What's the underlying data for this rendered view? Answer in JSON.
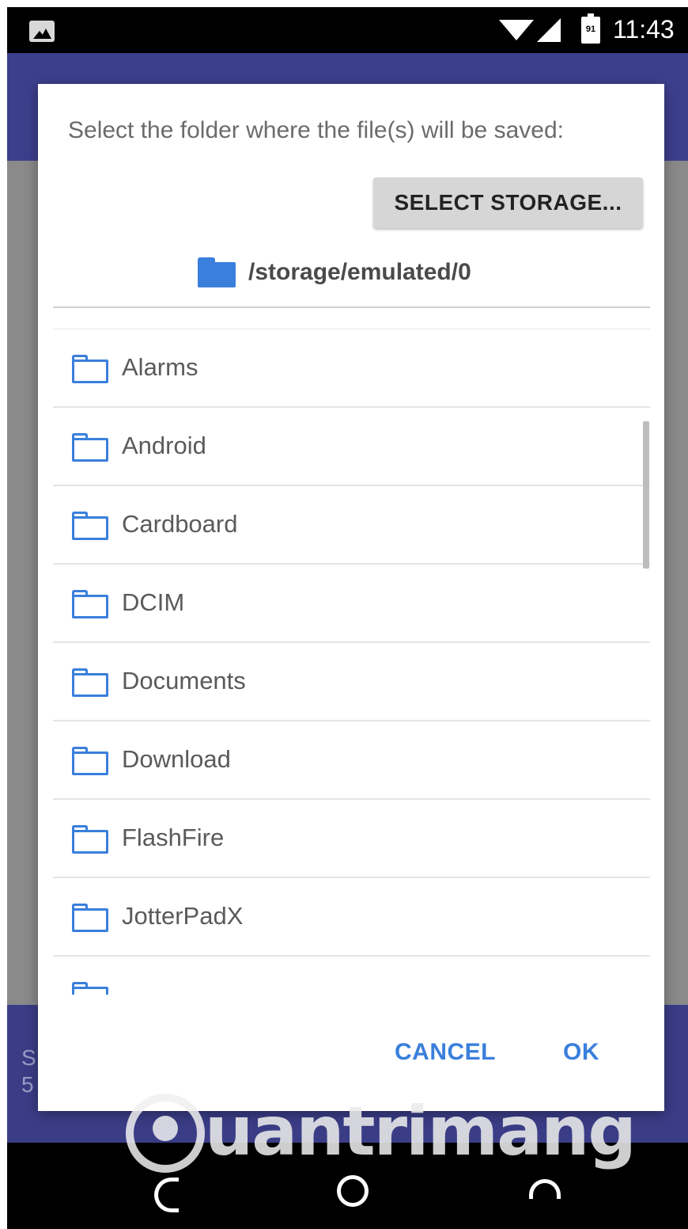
{
  "status_bar": {
    "time": "11:43",
    "battery_level": "91",
    "icons": [
      "image-notification-icon",
      "wifi-icon",
      "cell-signal-icon",
      "battery-icon"
    ]
  },
  "dialog": {
    "message": "Select the folder where the file(s) will be saved:",
    "select_storage_label": "SELECT STORAGE...",
    "current_path": "/storage/emulated/0",
    "folders": [
      {
        "name": "Alarms"
      },
      {
        "name": "Android"
      },
      {
        "name": "Cardboard"
      },
      {
        "name": "DCIM"
      },
      {
        "name": "Documents"
      },
      {
        "name": "Download"
      },
      {
        "name": "FlashFire"
      },
      {
        "name": "JotterPadX"
      }
    ],
    "cancel_label": "CANCEL",
    "ok_label": "OK"
  },
  "background": {
    "bottom_text_line1": "S",
    "bottom_text_line2": "5"
  },
  "watermark": {
    "text": "uantrimang"
  },
  "colors": {
    "accent": "#3a7fdc",
    "app_bar": "#3c3f8c",
    "dim_overlay": "#8a8a8a"
  }
}
